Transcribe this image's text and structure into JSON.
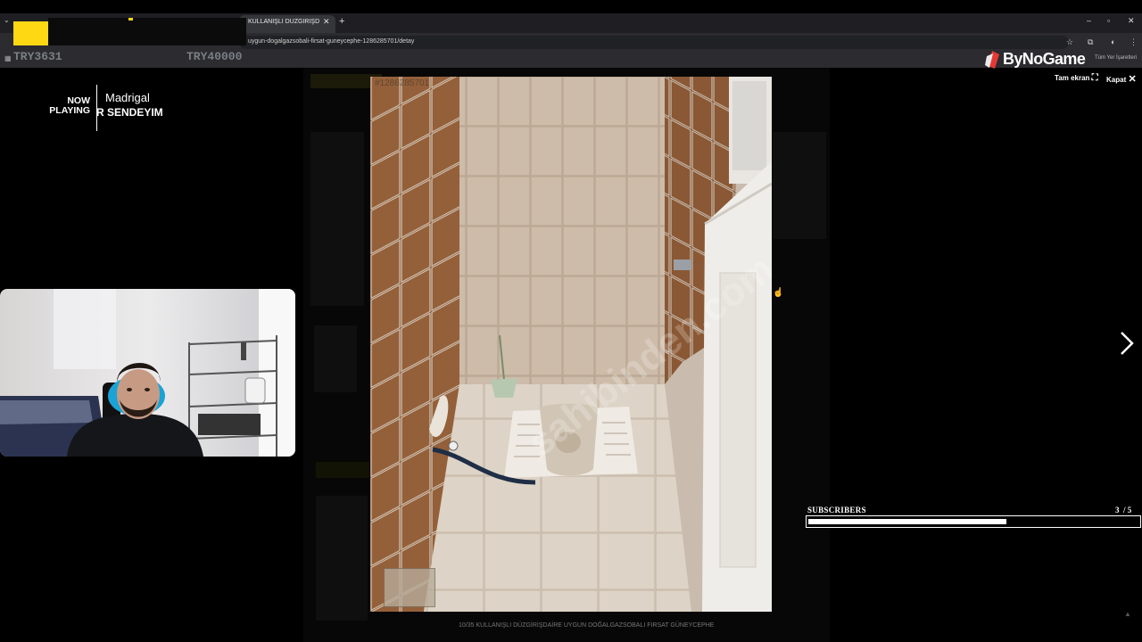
{
  "browser": {
    "tab_title": "KULLANIŞLI DÜZGİRİŞDAİRE U",
    "url": "uygun-dogalgazsobali-firsat-guneycephe-1286285701/detay",
    "bookmarks_all": "Tüm Yer İşaretleri"
  },
  "stream": {
    "donation_left": "TRY3631",
    "donation_right": "TRY40000",
    "logo_text": "ByNoGame"
  },
  "now_playing": {
    "label_line1": "NOW",
    "label_line2": "PLAYING",
    "artist": "Madrigal",
    "title": "R SENDEYIM"
  },
  "lightbox": {
    "listing_id": "#1286285701",
    "fullscreen_label": "Tam ekran",
    "close_label": "Kapat",
    "caption": "10/35    KULLANIŞLI DÜZGİRİŞDAİRE UYGUN DOĞALGAZSOBALI FIRSAT GÜNEYCEPHE",
    "watermark": "sahibinden.com"
  },
  "subscribers": {
    "label": "SUBSCRIBERS",
    "current": "3",
    "goal": "/ 5",
    "progress_fraction": 0.6
  },
  "colors": {
    "redaction_yellow": "#ffd814",
    "bar_fill": "#ffffff"
  }
}
